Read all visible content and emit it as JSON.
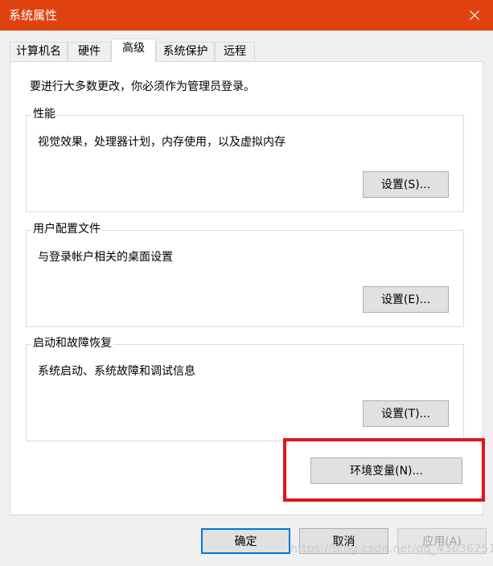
{
  "window": {
    "title": "系统属性"
  },
  "tabs": [
    {
      "label": "计算机名",
      "active": false
    },
    {
      "label": "硬件",
      "active": false
    },
    {
      "label": "高级",
      "active": true
    },
    {
      "label": "系统保护",
      "active": false
    },
    {
      "label": "远程",
      "active": false
    }
  ],
  "panel": {
    "admin_note": "要进行大多数更改，你必须作为管理员登录。",
    "performance": {
      "title": "性能",
      "desc": "视觉效果，处理器计划，内存使用，以及虚拟内存",
      "button": "设置(S)..."
    },
    "profiles": {
      "title": "用户配置文件",
      "desc": "与登录帐户相关的桌面设置",
      "button": "设置(E)..."
    },
    "startup": {
      "title": "启动和故障恢复",
      "desc": "系统启动、系统故障和调试信息",
      "button": "设置(T)..."
    },
    "env_button": "环境变量(N)..."
  },
  "footer": {
    "ok": "确定",
    "cancel": "取消",
    "apply": "应用(A)"
  },
  "watermark": "https://blog.csdn.net/qq_43636251",
  "colors": {
    "titlebar": "#e0420f",
    "highlight": "#e0161b",
    "default_button_border": "#0078d7"
  }
}
